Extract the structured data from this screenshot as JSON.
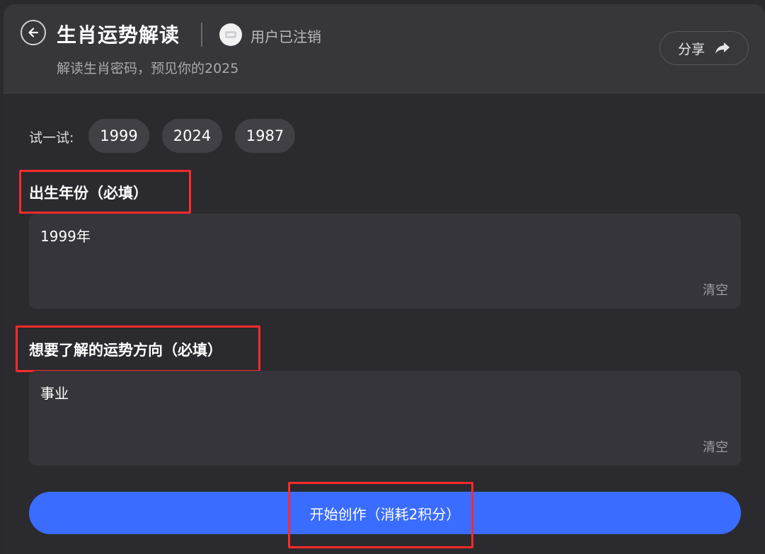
{
  "header": {
    "back_icon": "arrow-left-icon",
    "title": "生肖运势解读",
    "user_name": "用户已注销",
    "subtitle": "解读生肖密码，预见你的2025",
    "share_label": "分享",
    "share_icon": "share-arrow-icon"
  },
  "try": {
    "label": "试一试:",
    "examples": [
      "1999",
      "2024",
      "1987"
    ]
  },
  "birth_year": {
    "label": "出生年份（必填）",
    "value": "1999年",
    "clear_label": "清空"
  },
  "fortune_direction": {
    "label": "想要了解的运势方向（必填）",
    "value": "事业",
    "clear_label": "清空"
  },
  "submit": {
    "label": "开始创作（消耗2积分）"
  },
  "colors": {
    "accent": "#3a6cff",
    "highlight_box": "#ff2a2a",
    "background": "#2a2a2f"
  }
}
